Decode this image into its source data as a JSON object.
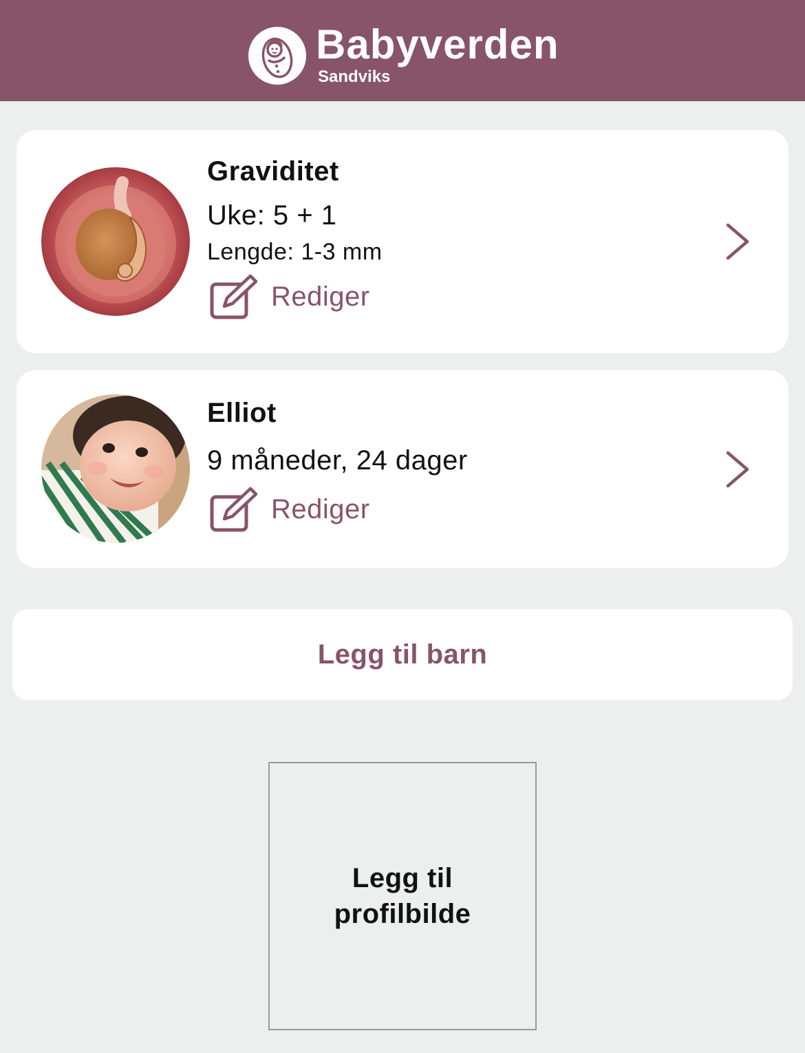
{
  "header": {
    "brand_title": "Babyverden",
    "brand_subtitle": "Sandviks",
    "logo_icon": "swaddled-baby-icon",
    "background_color": "#88546a"
  },
  "children": [
    {
      "name": "Graviditet",
      "primary_line": "Uke: 5 + 1",
      "secondary_line": "Lengde: 1-3 mm",
      "edit_label": "Rediger",
      "avatar_icon": "embryo-illustration"
    },
    {
      "name": "Elliot",
      "primary_line": "9 måneder, 24 dager",
      "edit_label": "Rediger",
      "avatar_icon": "baby-photo"
    }
  ],
  "add_child_label": "Legg til barn",
  "profile_picture_label": "Legg til profilbilde",
  "colors": {
    "accent": "#88546a",
    "background": "#ecefee",
    "card": "#ffffff"
  }
}
